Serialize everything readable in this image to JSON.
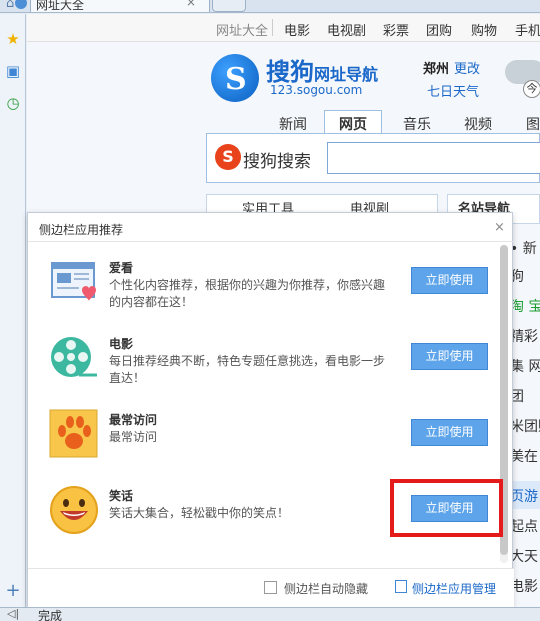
{
  "browser": {
    "tab_title": "网址大全",
    "status_text": "完成"
  },
  "page": {
    "topnav": [
      "网址大全",
      "电影",
      "电视剧",
      "彩票",
      "团购",
      "购物",
      "手机"
    ],
    "logo_title": "搜狗",
    "logo_subtitle": "网址导航",
    "logo_url": "123.sogou.com",
    "city": "郑州",
    "change": "更改",
    "weather": "七日天气",
    "today": "今",
    "search_tabs": [
      "新闻",
      "网页",
      "音乐",
      "视频",
      "图"
    ],
    "active_search_tab": "网页",
    "search_brand": "搜狗搜索",
    "lower_tabs": [
      "实用工具",
      "电视剧",
      "名站导航"
    ],
    "right_list": [
      "• 新",
      "狗",
      "淘 宝",
      "精彩",
      "集 网",
      "团",
      "米团购",
      "美在",
      "页游",
      "起点",
      "大天",
      "电影"
    ]
  },
  "panel": {
    "title": "侧边栏应用推荐",
    "items": [
      {
        "name": "爱看",
        "desc": "个性化内容推荐，根据你的兴趣为你推荐，你感兴趣的内容都在这！",
        "button": "立即使用",
        "icon": "reader-icon"
      },
      {
        "name": "电影",
        "desc": "每日推荐经典不断，特色专题任意挑选，看电影一步直达！",
        "button": "立即使用",
        "icon": "film-reel-icon"
      },
      {
        "name": "最常访问",
        "desc": "最常访问",
        "button": "立即使用",
        "icon": "paw-icon"
      },
      {
        "name": "笑话",
        "desc": "笑话大集合，轻松戳中你的笑点！",
        "button": "立即使用",
        "icon": "smiley-icon"
      }
    ],
    "auto_hide_label": "侧边栏自动隐藏",
    "manager_label": "侧边栏应用管理"
  },
  "colors": {
    "accent": "#5ea4ea",
    "highlight": "#e51b1b",
    "link": "#1a68c9"
  }
}
